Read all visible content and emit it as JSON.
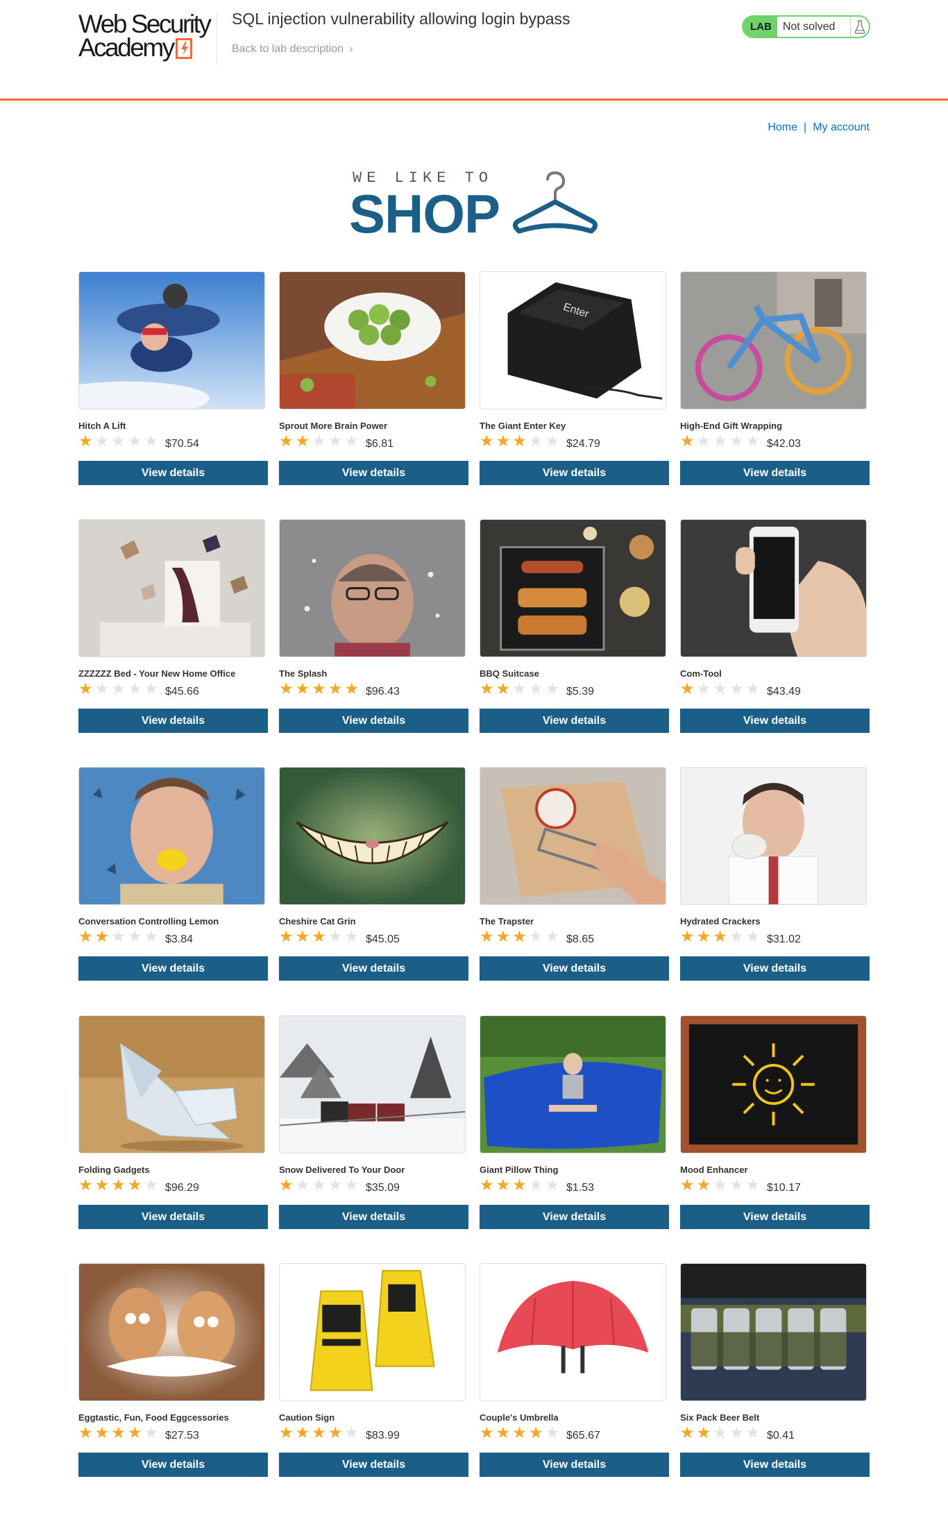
{
  "academy": {
    "logo_line1": "Web Security",
    "logo_line2": "Academy",
    "lab_title": "SQL injection vulnerability allowing login bypass",
    "back_link": "Back to lab description",
    "lab_badge": "LAB",
    "lab_status": "Not solved"
  },
  "nav": {
    "home": "Home",
    "separator": "|",
    "my_account": "My account"
  },
  "banner": {
    "small_text": "WE LIKE TO",
    "big_text": "SHOP"
  },
  "view_button_label": "View details",
  "colors": {
    "accent_orange": "#ff6633",
    "button_blue": "#1b5f88",
    "link_blue": "#0071bc",
    "status_green": "#70d16d",
    "star_gold": "#f5a623",
    "star_empty": "#e3e3e3"
  },
  "products": [
    {
      "name": "Hitch A Lift",
      "rating": 1,
      "price": "$70.54",
      "image": "skydivers"
    },
    {
      "name": "Sprout More Brain Power",
      "rating": 2,
      "price": "$6.81",
      "image": "brussels-sprouts"
    },
    {
      "name": "The Giant Enter Key",
      "rating": 3,
      "price": "$24.79",
      "image": "giant-enter-key"
    },
    {
      "name": "High-End Gift Wrapping",
      "rating": 1,
      "price": "$42.03",
      "image": "knitted-bicycle"
    },
    {
      "name": "ZZZZZZ Bed - Your New Home Office",
      "rating": 1,
      "price": "$45.66",
      "image": "flying-books-bed"
    },
    {
      "name": "The Splash",
      "rating": 5,
      "price": "$96.43",
      "image": "water-splash-face"
    },
    {
      "name": "BBQ Suitcase",
      "rating": 2,
      "price": "$5.39",
      "image": "bbq-grill"
    },
    {
      "name": "Com-Tool",
      "rating": 1,
      "price": "$43.49",
      "image": "hand-holding-phone"
    },
    {
      "name": "Conversation Controlling Lemon",
      "rating": 2,
      "price": "$3.84",
      "image": "man-with-lemon"
    },
    {
      "name": "Cheshire Cat Grin",
      "rating": 3,
      "price": "$45.05",
      "image": "cheshire-grin"
    },
    {
      "name": "The Trapster",
      "rating": 3,
      "price": "$8.65",
      "image": "mouse-trap-finger"
    },
    {
      "name": "Hydrated Crackers",
      "rating": 3,
      "price": "$31.02",
      "image": "man-eating-cracker"
    },
    {
      "name": "Folding Gadgets",
      "rating": 4,
      "price": "$96.29",
      "image": "origami-bird"
    },
    {
      "name": "Snow Delivered To Your Door",
      "rating": 1,
      "price": "$35.09",
      "image": "snowy-train"
    },
    {
      "name": "Giant Pillow Thing",
      "rating": 3,
      "price": "$1.53",
      "image": "girl-on-bean-bag"
    },
    {
      "name": "Mood Enhancer",
      "rating": 2,
      "price": "$10.17",
      "image": "chalkboard-sun"
    },
    {
      "name": "Eggtastic, Fun, Food Eggcessories",
      "rating": 4,
      "price": "$27.53",
      "image": "eggs-with-mustaches"
    },
    {
      "name": "Caution Sign",
      "rating": 4,
      "price": "$83.99",
      "image": "caution-signs"
    },
    {
      "name": "Couple's Umbrella",
      "rating": 4,
      "price": "$65.67",
      "image": "red-umbrella"
    },
    {
      "name": "Six Pack Beer Belt",
      "rating": 2,
      "price": "$0.41",
      "image": "beer-belt"
    }
  ]
}
